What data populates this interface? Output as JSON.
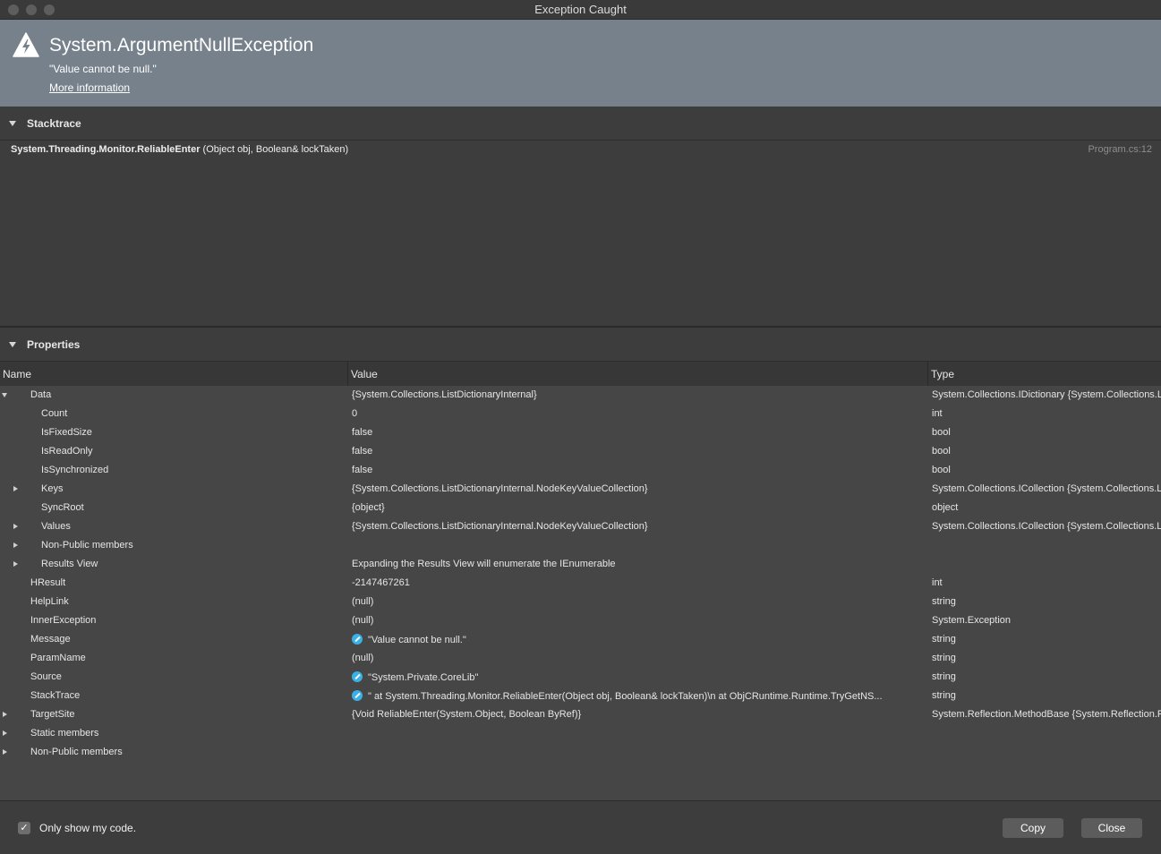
{
  "window": {
    "title": "Exception Caught"
  },
  "exception": {
    "type": "System.ArgumentNullException",
    "message": "\"Value cannot be null.\"",
    "more_info_label": "More information"
  },
  "stacktrace": {
    "heading": "Stacktrace",
    "frames": [
      {
        "function": "System.Threading.Monitor.ReliableEnter",
        "args": " (Object obj, Boolean& lockTaken)",
        "location": "Program.cs:12"
      }
    ]
  },
  "properties": {
    "heading": "Properties",
    "columns": {
      "name": "Name",
      "value": "Value",
      "type": "Type"
    },
    "rows": [
      {
        "name": "Data",
        "value": "{System.Collections.ListDictionaryInternal}",
        "type": "System.Collections.IDictionary {System.Collections.ListDictionaryInternal}"
      },
      {
        "name": "Count",
        "value": "0",
        "type": "int"
      },
      {
        "name": "IsFixedSize",
        "value": "false",
        "type": "bool"
      },
      {
        "name": "IsReadOnly",
        "value": "false",
        "type": "bool"
      },
      {
        "name": "IsSynchronized",
        "value": "false",
        "type": "bool"
      },
      {
        "name": "Keys",
        "value": "{System.Collections.ListDictionaryInternal.NodeKeyValueCollection}",
        "type": "System.Collections.ICollection {System.Collections.ListDictionaryInternal.NodeKeyValueCollection}"
      },
      {
        "name": "SyncRoot",
        "value": "{object}",
        "type": "object"
      },
      {
        "name": "Values",
        "value": "{System.Collections.ListDictionaryInternal.NodeKeyValueCollection}",
        "type": "System.Collections.ICollection {System.Collections.ListDictionaryInternal.NodeKeyValueCollection}"
      },
      {
        "name": "Non-Public members",
        "value": "",
        "type": ""
      },
      {
        "name": "Results View",
        "value": "Expanding the Results View will enumerate the IEnumerable",
        "type": ""
      },
      {
        "name": "HResult",
        "value": "-2147467261",
        "type": "int"
      },
      {
        "name": "HelpLink",
        "value": "(null)",
        "type": "string"
      },
      {
        "name": "InnerException",
        "value": "(null)",
        "type": "System.Exception"
      },
      {
        "name": "Message",
        "value": "\"Value cannot be null.\"",
        "type": "string"
      },
      {
        "name": "ParamName",
        "value": "(null)",
        "type": "string"
      },
      {
        "name": "Source",
        "value": "\"System.Private.CoreLib\"",
        "type": "string"
      },
      {
        "name": "StackTrace",
        "value": "\"   at System.Threading.Monitor.ReliableEnter(Object obj, Boolean& lockTaken)\\n   at ObjCRuntime.Runtime.TryGetNS...",
        "type": "string"
      },
      {
        "name": "TargetSite",
        "value": "{Void ReliableEnter(System.Object, Boolean ByRef)}",
        "type": "System.Reflection.MethodBase {System.Reflection.RuntimeMethodInfo}"
      },
      {
        "name": "Static members",
        "value": "",
        "type": ""
      },
      {
        "name": "Non-Public members",
        "value": "",
        "type": ""
      }
    ]
  },
  "footer": {
    "only_my_code_label": "Only show my code.",
    "only_my_code_checked": "✓",
    "copy_label": "Copy",
    "close_label": "Close"
  },
  "colors": {
    "header_bg": "#77818b",
    "edit_icon": "#3ab1e6",
    "panel_bg": "#3d3d3d"
  }
}
